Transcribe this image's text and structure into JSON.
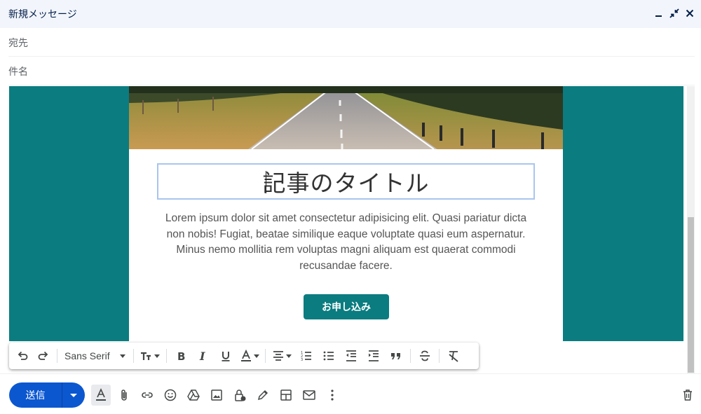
{
  "window": {
    "title": "新規メッセージ",
    "controls": [
      "minimize-icon",
      "exit-fullscreen-icon",
      "close-icon"
    ]
  },
  "fields": {
    "to_label": "宛先",
    "subject_label": "件名"
  },
  "email_body": {
    "heading": "記事のタイトル",
    "paragraph": "Lorem ipsum dolor sit amet consectetur adipisicing elit. Quasi pariatur dicta non nobis! Fugiat, beatae similique eaque voluptate quasi eum aspernatur. Minus nemo mollitia rem voluptas magni aliquam est quaerat commodi recusandae facere.",
    "cta_label": "お申し込み",
    "background_color": "#0b7c80",
    "accent_color": "#0b7c80"
  },
  "format_toolbar": {
    "font": "Sans Serif",
    "buttons": [
      "undo-icon",
      "redo-icon",
      "font-select",
      "text-size-icon",
      "bold-icon",
      "italic-icon",
      "underline-icon",
      "text-color-icon",
      "align-icon",
      "numbered-list-icon",
      "bulleted-list-icon",
      "indent-less-icon",
      "indent-more-icon",
      "quote-icon",
      "strikethrough-icon",
      "clear-formatting-icon"
    ]
  },
  "bottom_bar": {
    "send_label": "送信",
    "send_color": "#0b57d0",
    "icons": [
      "formatting-options-icon",
      "attach-icon",
      "link-icon",
      "emoji-icon",
      "drive-icon",
      "photo-icon",
      "confidential-mode-icon",
      "signature-icon",
      "layout-icon",
      "template-icon",
      "more-options-icon",
      "trash-icon"
    ]
  }
}
